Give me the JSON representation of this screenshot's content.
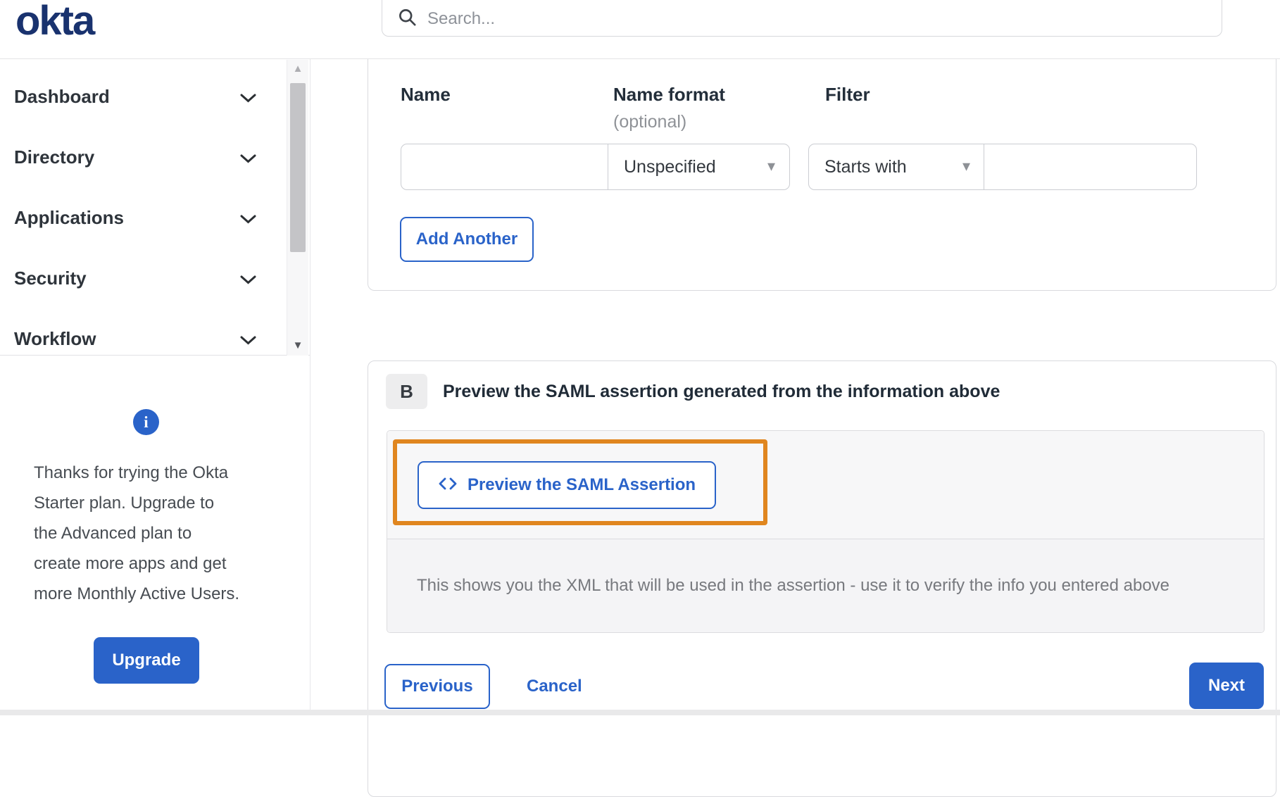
{
  "header": {
    "logo_text": "okta",
    "search_placeholder": "Search...",
    "search_value": ""
  },
  "sidebar": {
    "items": [
      {
        "label": "Dashboard"
      },
      {
        "label": "Directory"
      },
      {
        "label": "Applications"
      },
      {
        "label": "Security"
      },
      {
        "label": "Workflow"
      }
    ],
    "info_lines": [
      "Thanks for trying the Okta",
      "Starter plan. Upgrade to",
      "the Advanced plan to",
      "create more apps and get",
      "more Monthly Active Users."
    ],
    "upgrade_label": "Upgrade"
  },
  "form": {
    "col_name": "Name",
    "col_name_format": "Name format",
    "col_name_format_hint": "(optional)",
    "col_filter": "Filter",
    "name_value": "",
    "name_format_value": "Unspecified",
    "filter_type_value": "Starts with",
    "filter_value": "",
    "add_another_label": "Add Another"
  },
  "section_b": {
    "badge": "B",
    "title": "Preview the SAML assertion generated from the information above",
    "preview_button_label": "Preview the SAML Assertion",
    "caption": "This shows you the XML that will be used in the assertion - use it to verify the info you entered above"
  },
  "nav_buttons": {
    "previous": "Previous",
    "cancel": "Cancel",
    "next": "Next"
  },
  "icons": {
    "info_glyph": "i",
    "dropdown_caret": "▾",
    "scroll_up_glyph": "▲",
    "scroll_down_glyph": "▼"
  },
  "colors": {
    "accent_blue": "#2a63c9",
    "logo_navy": "#19326e",
    "highlight_orange": "#e0861f",
    "caption_gray": "#77797e"
  }
}
